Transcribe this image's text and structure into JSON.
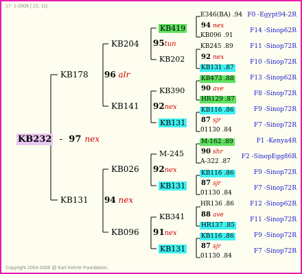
{
  "header": "17-  1-2006 ( 21: 11)",
  "footer": "Copyright 2004-2006 @ Karl Kehrle Foundation.",
  "root": {
    "name": "KB232",
    "score": "97",
    "tag": "nex"
  },
  "gen1": [
    {
      "name": "KB178",
      "score": "96",
      "tag": "alr"
    },
    {
      "name": "KB131",
      "score": "94",
      "tag": "nex"
    }
  ],
  "gen2": [
    {
      "name": "KB204",
      "score": "95",
      "tag": "tun"
    },
    {
      "name": "KB141",
      "score": "92",
      "tag": "nex"
    },
    {
      "name": "KB026",
      "score": "92",
      "tag": "nex"
    },
    {
      "name": "KB096",
      "score": "91",
      "tag": "nex"
    }
  ],
  "gen3": [
    {
      "name": "KB419"
    },
    {
      "name": "KB202"
    },
    {
      "name": "KB390"
    },
    {
      "name": "KB131"
    },
    {
      "name": "M-245"
    },
    {
      "name": "KB131"
    },
    {
      "name": "KB341"
    },
    {
      "name": "KB131"
    }
  ],
  "gen4": [
    {
      "top": "E346(BA) .94",
      "score": "94",
      "tag": "nex",
      "bottom": "KB096 .91"
    },
    {
      "top": "KB245 .89",
      "score": "92",
      "tag": "nex",
      "bottom": "KB131 .87"
    },
    {
      "top": "KB473 .88",
      "score": "90",
      "tag": "ave",
      "bottom": "HR129 .87"
    },
    {
      "top": "KB116 .86",
      "score": "87",
      "tag": "sjr",
      "bottom": "01130 .84"
    },
    {
      "top": "M-162 .89",
      "score": "90",
      "tag": "shr",
      "bottom": "A-322 .87"
    },
    {
      "top": "KB116 .86",
      "score": "87",
      "tag": "sjr",
      "bottom": "01130 .84"
    },
    {
      "top": "HR136 .86",
      "score": "88",
      "tag": "ave",
      "bottom": "HR137 .85"
    },
    {
      "top": "KB116 .86",
      "score": "87",
      "tag": "sjr",
      "bottom": "01130 .84"
    }
  ],
  "pedigrees": [
    "F0 -Egypt94-2R",
    "F14 -Sinop62R",
    "F11 -Sinop72R",
    "F10 -Sinop72R",
    "F13 -Sinop62R",
    "F8 -Sinop72R",
    "F9 -Sinop72R",
    "F7 -Sinop72R",
    "F1 -Kenya4R",
    "F2 -SinopEgg86R",
    "F9 -Sinop72R",
    "F7 -Sinop72R",
    "F12 -Sinop62R",
    "F11 -Sinop72R",
    "F9 -Sinop72R",
    "F7 -Sinop72R"
  ]
}
